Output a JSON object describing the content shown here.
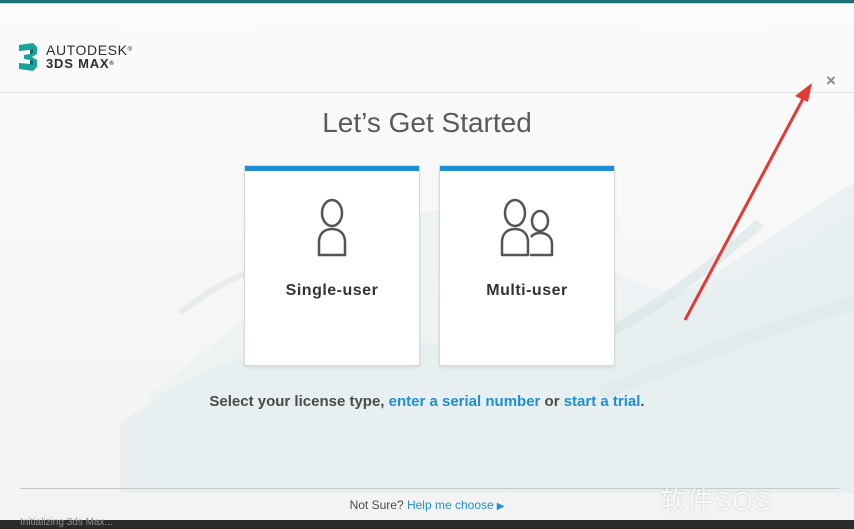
{
  "app": {
    "brand_line1": "AUTODESK",
    "brand_line2": "3DS MAX",
    "close_label": "×"
  },
  "main": {
    "title": "Let’s Get Started",
    "options": [
      {
        "label": "Single-user",
        "icon": "single-user-icon"
      },
      {
        "label": "Multi-user",
        "icon": "multi-user-icon"
      }
    ],
    "prompt": {
      "prefix": "Select your license type, ",
      "serial_link": "enter a serial number",
      "middle": " or ",
      "trial_link": "start a trial",
      "suffix": "."
    }
  },
  "footer": {
    "not_sure": "Not Sure?",
    "help_link": "Help me choose",
    "help_arrow_icon": "play-arrow-icon"
  },
  "status": {
    "text": "Initializing 3ds Max..."
  },
  "watermark": {
    "text": "软件SOS"
  },
  "colors": {
    "accent": "#1e8fd6",
    "brand_teal": "#1f6f79",
    "annotation_red": "#e53935"
  }
}
